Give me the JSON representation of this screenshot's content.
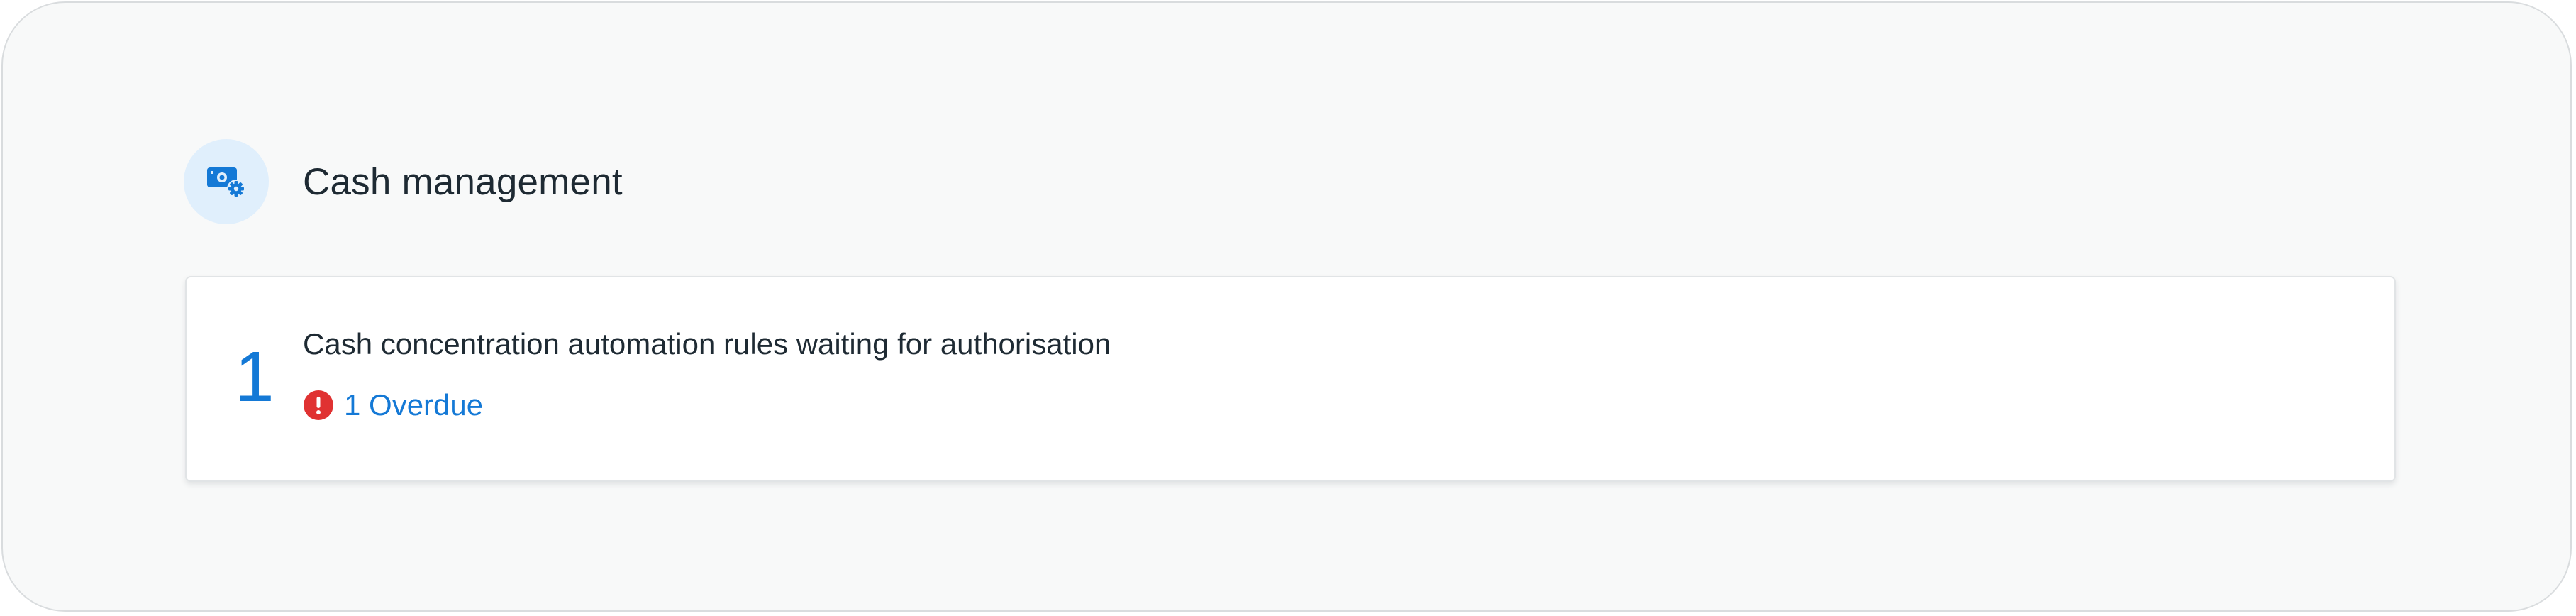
{
  "section": {
    "title": "Cash management",
    "icon": "cash-settings-icon",
    "icon_color": "#1479d6",
    "icon_bg": "#e0effc"
  },
  "task": {
    "count": "1",
    "description": "Cash concentration automation rules waiting for authorisation",
    "overdue_label": "1 Overdue",
    "overdue_icon": "error-icon",
    "overdue_icon_color": "#e03232",
    "link_color": "#1479d6"
  }
}
